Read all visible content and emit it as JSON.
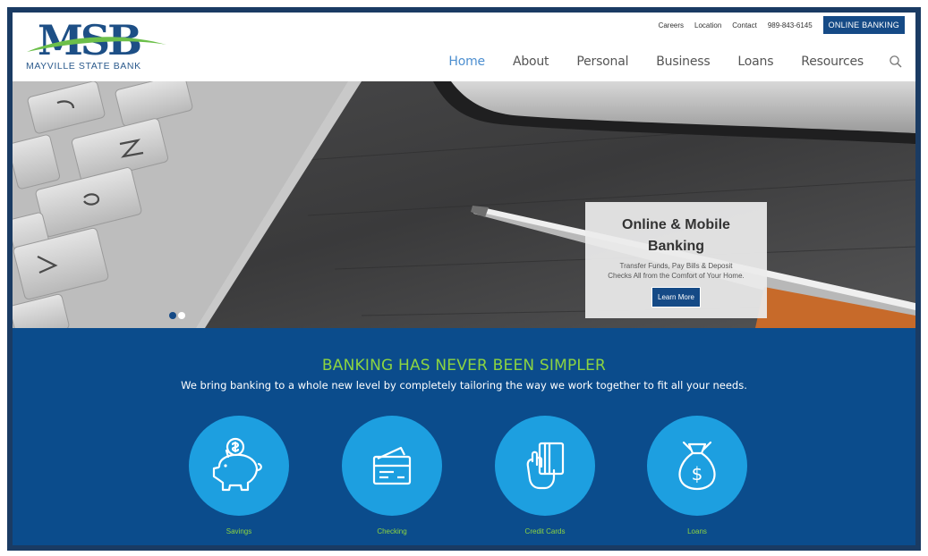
{
  "brand": {
    "logo_text": "MSB",
    "name": "MAYVILLE STATE BANK",
    "colors": {
      "navy": "#1a3b63",
      "blue": "#0b4c8c",
      "accent": "#1d9fe0",
      "green": "#8cd441"
    }
  },
  "utility_nav": {
    "links": [
      "Careers",
      "Location",
      "Contact",
      "989-843-6145"
    ],
    "online_banking": "ONLINE BANKING"
  },
  "main_nav": {
    "items": [
      "Home",
      "About",
      "Personal",
      "Business",
      "Loans",
      "Resources"
    ],
    "active": "Home",
    "search_icon": "search-icon"
  },
  "hero": {
    "promo": {
      "title_line1": "Online & Mobile",
      "title_line2": "Banking",
      "text_line1": "Transfer Funds, Pay Bills & Deposit",
      "text_line2": "Checks All from the Comfort of Your Home.",
      "button": "Learn More"
    },
    "slides": {
      "count": 2,
      "active": 1
    }
  },
  "intro": {
    "headline": "BANKING HAS NEVER BEEN SIMPLER",
    "subline": "We bring banking to a whole new level by completely tailoring the way we work together to fit all your needs."
  },
  "services": [
    {
      "label": "Savings",
      "icon": "piggy-bank-icon"
    },
    {
      "label": "Checking",
      "icon": "checkbook-icon"
    },
    {
      "label": "Credit Cards",
      "icon": "card-hand-icon"
    },
    {
      "label": "Loans",
      "icon": "money-bag-icon"
    }
  ]
}
